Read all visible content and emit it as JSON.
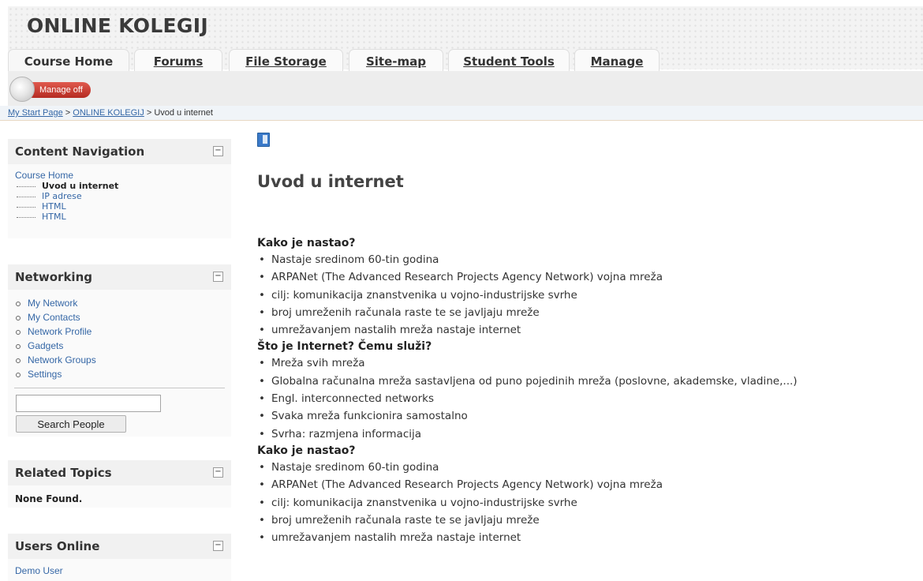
{
  "header": {
    "site_title": "ONLINE KOLEGIJ",
    "tabs": [
      {
        "label": "Course Home",
        "active": true
      },
      {
        "label": "Forums",
        "active": false
      },
      {
        "label": "File Storage",
        "active": false
      },
      {
        "label": "Site-map",
        "active": false
      },
      {
        "label": "Student Tools",
        "active": false
      },
      {
        "label": "Manage",
        "active": false
      }
    ]
  },
  "toolbar": {
    "manage_label": "Manage off"
  },
  "breadcrumb": {
    "items": [
      "My Start Page",
      "ONLINE KOLEGIJ",
      "Uvod u internet"
    ],
    "separator": ">"
  },
  "sidebar": {
    "content_navigation": {
      "title": "Content Navigation",
      "root": "Course Home",
      "items": [
        "Uvod u internet",
        "IP adrese",
        "HTML",
        "HTML"
      ],
      "current": "Uvod u internet"
    },
    "networking": {
      "title": "Networking",
      "items": [
        "My Network",
        "My Contacts",
        "Network Profile",
        "Gadgets",
        "Network Groups",
        "Settings"
      ],
      "search_value": "",
      "search_button": "Search People"
    },
    "related_topics": {
      "title": "Related Topics",
      "text": "None Found."
    },
    "users_online": {
      "title": "Users Online",
      "users": [
        "Demo User"
      ]
    }
  },
  "main": {
    "title": "Uvod u internet",
    "sections": [
      {
        "heading": "Kako je nastao?",
        "bullets": [
          "Nastaje sredinom 60-tin godina",
          "ARPANet (The Advanced Research Projects Agency Network) vojna mreža",
          "cilj: komunikacija znanstvenika u vojno-industrijske svrhe",
          "broj umreženih računala raste te se javljaju mreže",
          "umrežavanjem nastalih mreža nastaje internet"
        ]
      },
      {
        "heading": "Što je Internet? Čemu služi?",
        "bullets": [
          "Mreža svih mreža",
          "Globalna računalna mreža sastavljena od puno pojedinih mreža (poslovne, akademske, vladine,...)",
          "Engl. interconnected networks",
          "Svaka mreža funkcionira samostalno",
          "Svrha: razmjena informacija"
        ]
      },
      {
        "heading": "Kako je nastao?",
        "bullets": [
          "Nastaje sredinom 60-tin godina",
          "ARPANet (The Advanced Research Projects Agency Network) vojna mreža",
          "cilj: komunikacija znanstvenika u vojno-industrijske svrhe",
          "broj umreženih računala raste te se javljaju mreže",
          "umrežavanjem nastalih mreža nastaje internet"
        ]
      }
    ]
  },
  "colors": {
    "accent_orange": "#d9822b",
    "link_blue": "#3567a6",
    "manage_red": "#c43a30"
  }
}
